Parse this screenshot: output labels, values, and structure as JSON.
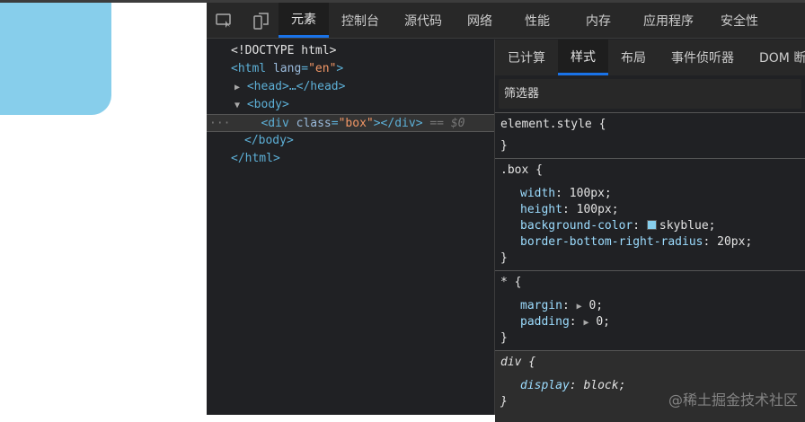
{
  "page": {
    "box_color": "#87ceeb"
  },
  "toolbar": {
    "tabs": [
      "元素",
      "控制台",
      "源代码",
      "网络",
      "性能",
      "内存",
      "应用程序",
      "安全性"
    ],
    "active": 0
  },
  "elements": {
    "lines": [
      {
        "t": "<!DOCTYPE html>"
      },
      {
        "open": "<html ",
        "attr": "lang",
        "val": "\"en\"",
        "close": ">"
      },
      {
        "head": "<head>…</head>"
      },
      {
        "body": "<body>"
      },
      {
        "div_open": "<div ",
        "attr": "class",
        "val": "\"box\"",
        "div_close": "></div>",
        "ref": "== $0"
      },
      {
        "t": "</body>"
      },
      {
        "t": "</html>"
      }
    ],
    "dots": "···"
  },
  "styles": {
    "tabs": [
      "已计算",
      "样式",
      "布局",
      "事件侦听器",
      "DOM 断"
    ],
    "filter_placeholder": "筛选器",
    "rules": {
      "element": {
        "selector": "element.style {",
        "close": "}"
      },
      "box": {
        "selector": ".box {",
        "props": [
          [
            "width",
            "100px;"
          ],
          [
            "height",
            "100px;"
          ],
          [
            "background-color",
            "skyblue;"
          ],
          [
            "border-bottom-right-radius",
            "20px;"
          ]
        ],
        "close": "}"
      },
      "star": {
        "selector": "* {",
        "props": [
          [
            "margin",
            "0;"
          ],
          [
            "padding",
            "0;"
          ]
        ],
        "close": "}"
      },
      "div": {
        "selector": "div {",
        "props": [
          [
            "display",
            "block;"
          ]
        ],
        "close": "}"
      }
    }
  },
  "watermark": "@稀土掘金技术社区"
}
